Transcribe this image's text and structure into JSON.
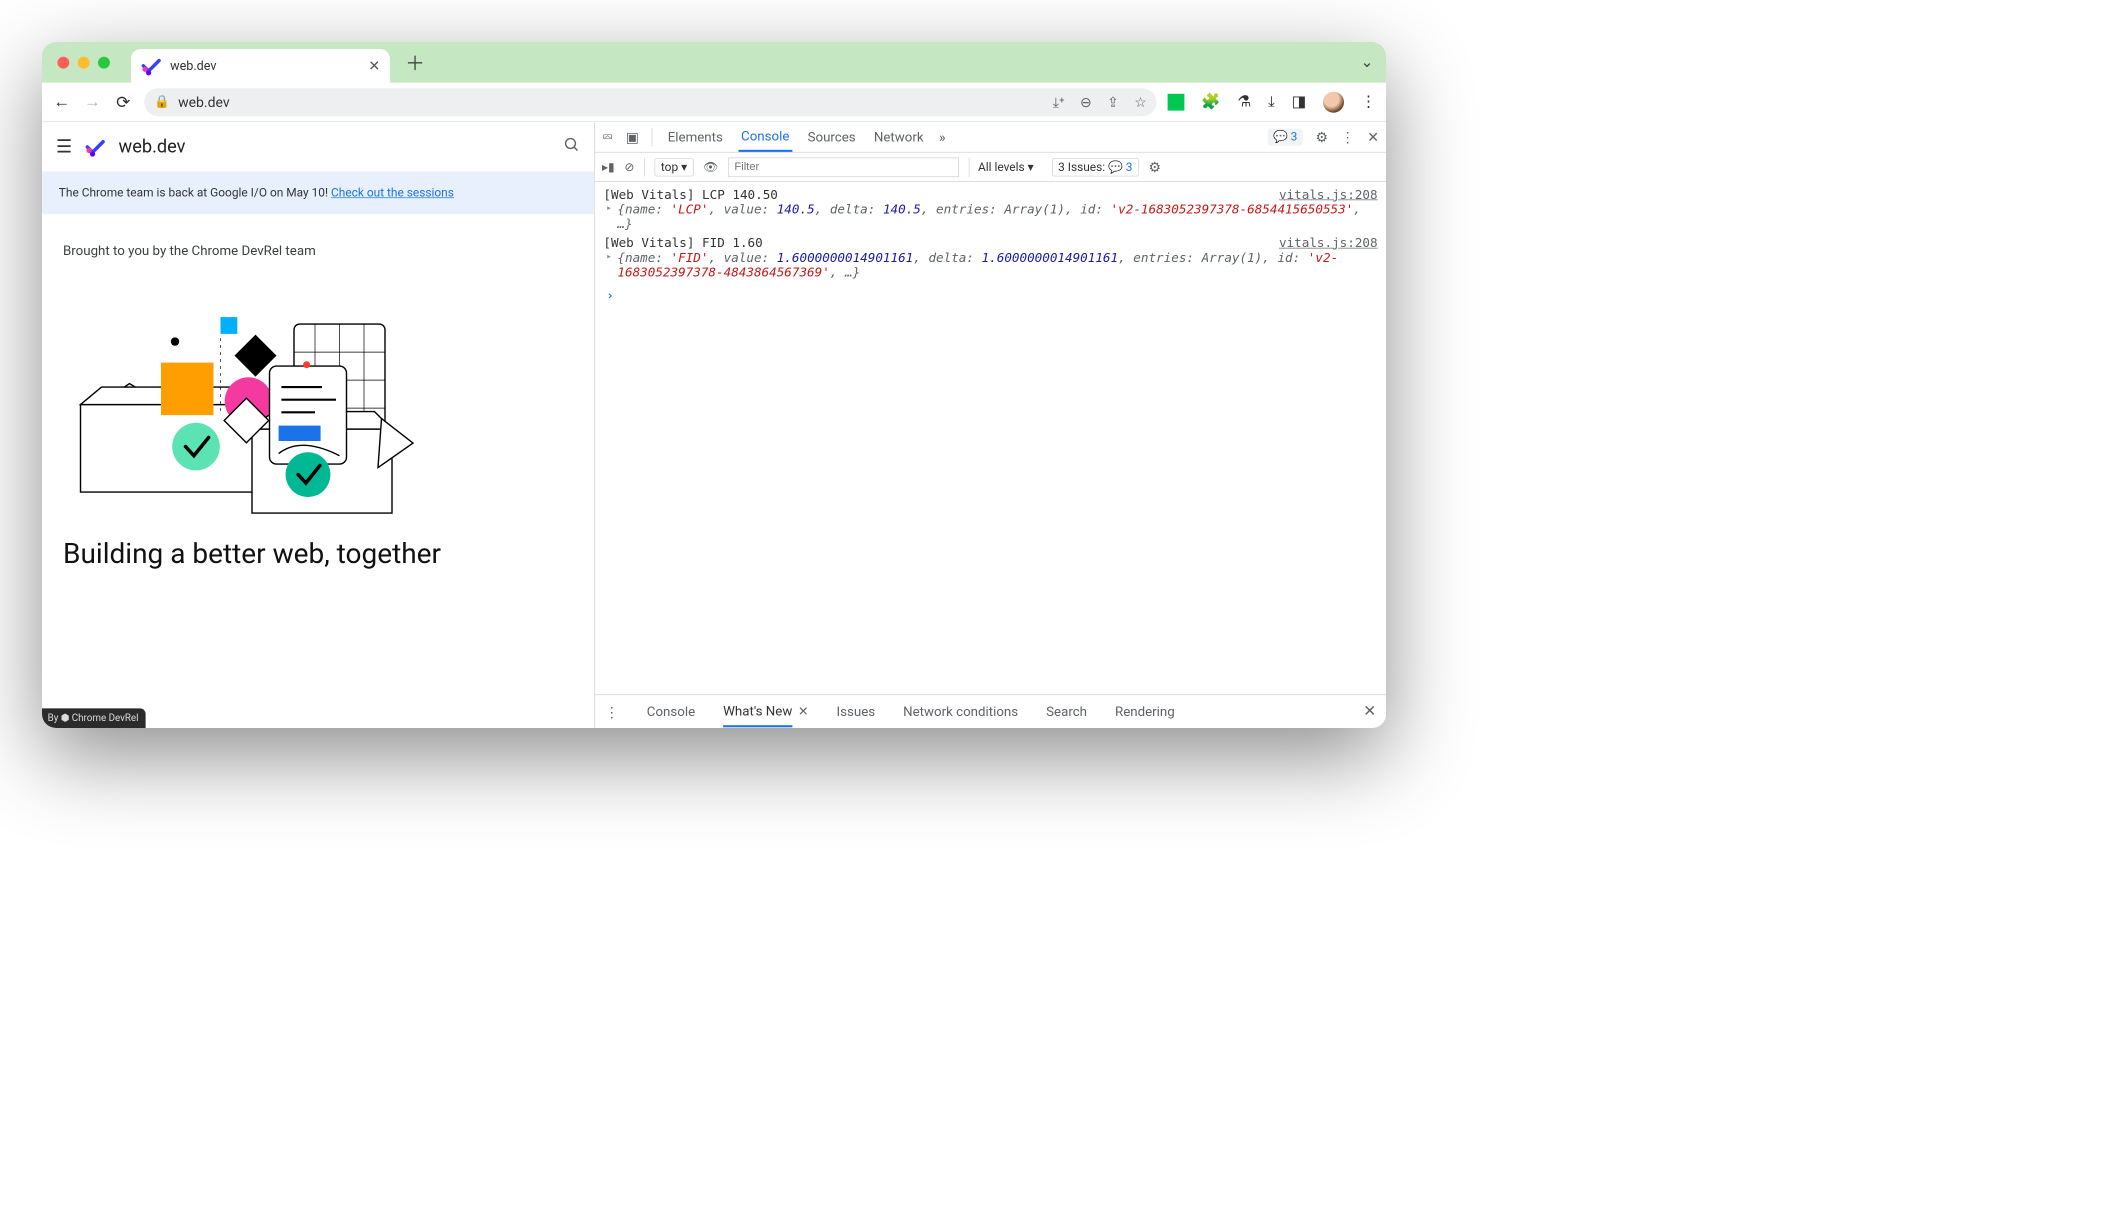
{
  "browser": {
    "tab_title": "web.dev",
    "url": "web.dev"
  },
  "page": {
    "brand": "web.dev",
    "banner_prefix": "The Chrome team is back at Google I/O on May 10! ",
    "banner_link": "Check out the sessions",
    "kicker": "Brought to you by the Chrome DevRel team",
    "headline": "Building a better web, together",
    "badge": "By ⬢ Chrome DevRel"
  },
  "devtools": {
    "tabs": {
      "elements": "Elements",
      "console": "Console",
      "sources": "Sources",
      "network": "Network"
    },
    "messages_badge": "3",
    "toolbar": {
      "context": "top",
      "filter_placeholder": "Filter",
      "levels": "All levels",
      "issues_prefix": "3 Issues:",
      "issues_count": "3"
    },
    "logs": [
      {
        "title": "[Web Vitals] LCP 140.50",
        "source": "vitals.js:208",
        "obj": {
          "name": "'LCP'",
          "value": "140.5",
          "delta": "140.5",
          "entries": "Array(1)",
          "id": "'v2-1683052397378-6854415650553'"
        }
      },
      {
        "title": "[Web Vitals] FID 1.60",
        "source": "vitals.js:208",
        "obj": {
          "name": "'FID'",
          "value": "1.6000000014901161",
          "delta": "1.6000000014901161",
          "entries": "Array(1)",
          "id": "'v2-1683052397378-4843864567369'"
        }
      }
    ],
    "drawer": {
      "console": "Console",
      "whatsnew": "What's New",
      "issues": "Issues",
      "netcond": "Network conditions",
      "search": "Search",
      "rendering": "Rendering"
    }
  }
}
